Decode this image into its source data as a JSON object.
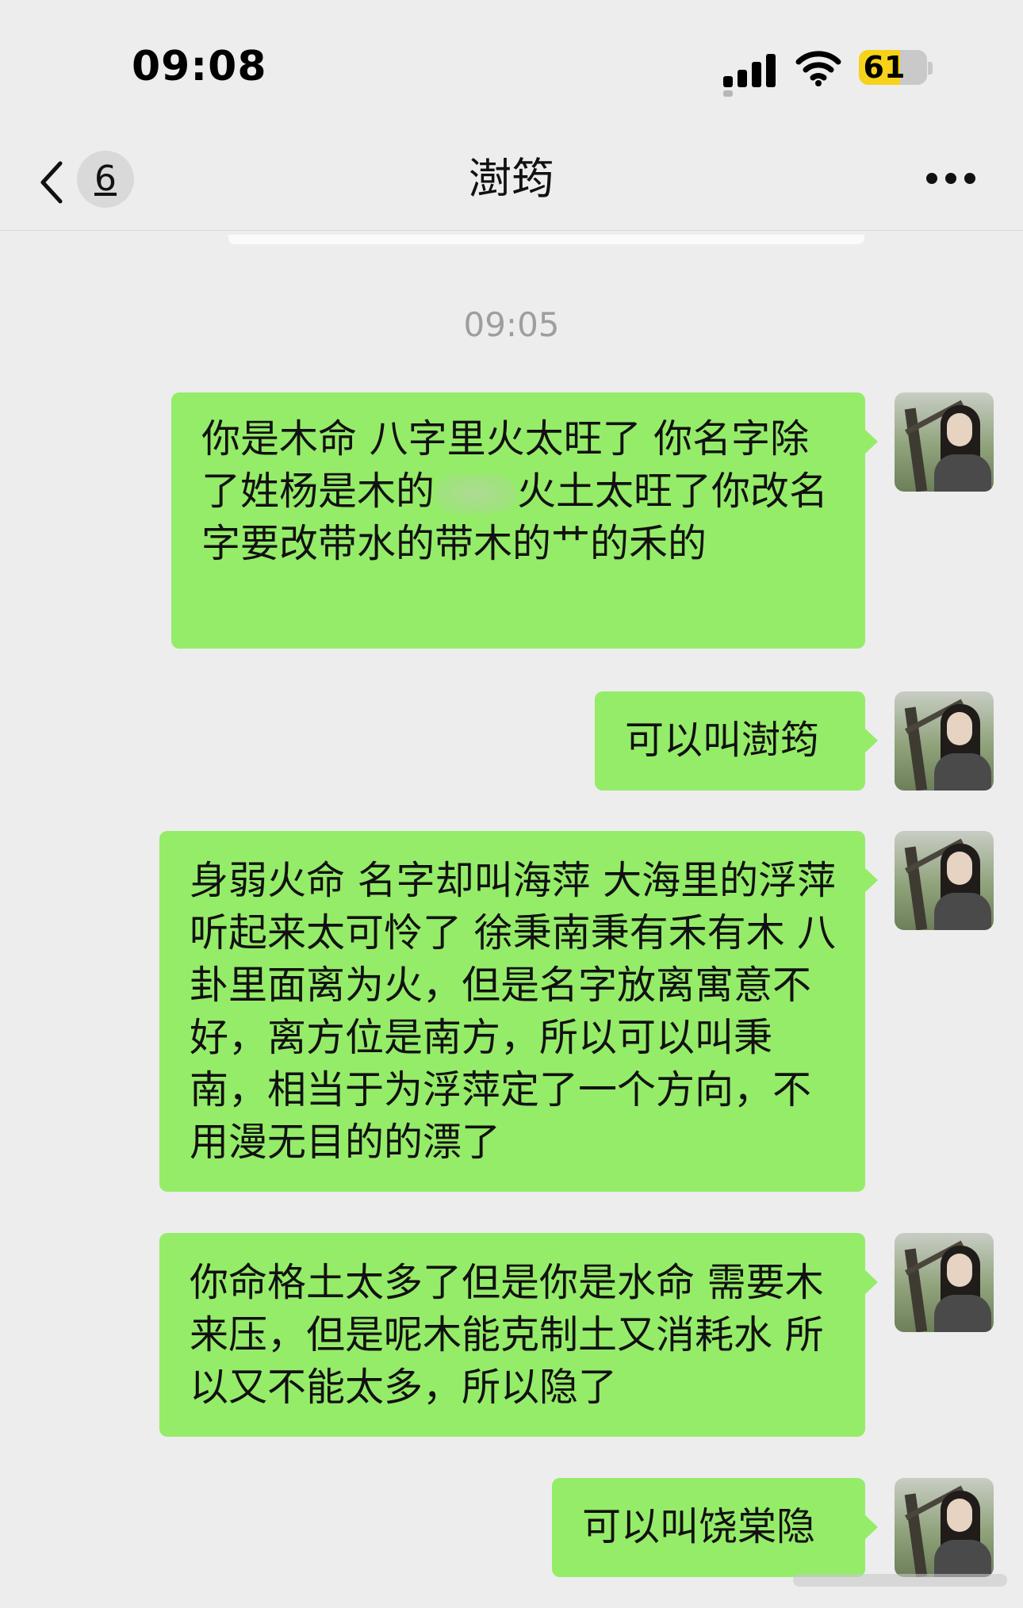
{
  "status_bar": {
    "time": "09:08",
    "battery_percent": "61",
    "battery_level": 0.61,
    "icons": [
      "signal-icon",
      "wifi-icon",
      "battery-icon"
    ]
  },
  "nav": {
    "back_icon": "chevron-left-icon",
    "unread_count": "6",
    "title": "澍筠",
    "more_icon": "more-dots-icon"
  },
  "chat": {
    "timestamp": "09:05",
    "messages": [
      {
        "sender": "self",
        "segments": [
          "你是木命 八字里火太旺了 你名字除了姓杨是木的",
          "火土太旺了你改名字要改带水的带木的艹的禾的"
        ],
        "has_redaction": true
      },
      {
        "sender": "self",
        "text": "可以叫澍筠"
      },
      {
        "sender": "self",
        "text": "身弱火命 名字却叫海萍 大海里的浮萍 听起来太可怜了 徐秉南秉有禾有木 八卦里面离为火，但是名字放离寓意不好，离方位是南方，所以可以叫秉南，相当于为浮萍定了一个方向，不用漫无目的的漂了"
      },
      {
        "sender": "self",
        "text": "你命格土太多了但是你是水命 需要木来压，但是呢木能克制土又消耗水 所以又不能太多，所以隐了"
      },
      {
        "sender": "self",
        "text": "可以叫饶棠隐"
      }
    ]
  },
  "colors": {
    "background": "#ededed",
    "bubble_self": "#95ec69",
    "timestamp_text": "#9e9e9e",
    "battery_fill": "#f6d21a"
  }
}
